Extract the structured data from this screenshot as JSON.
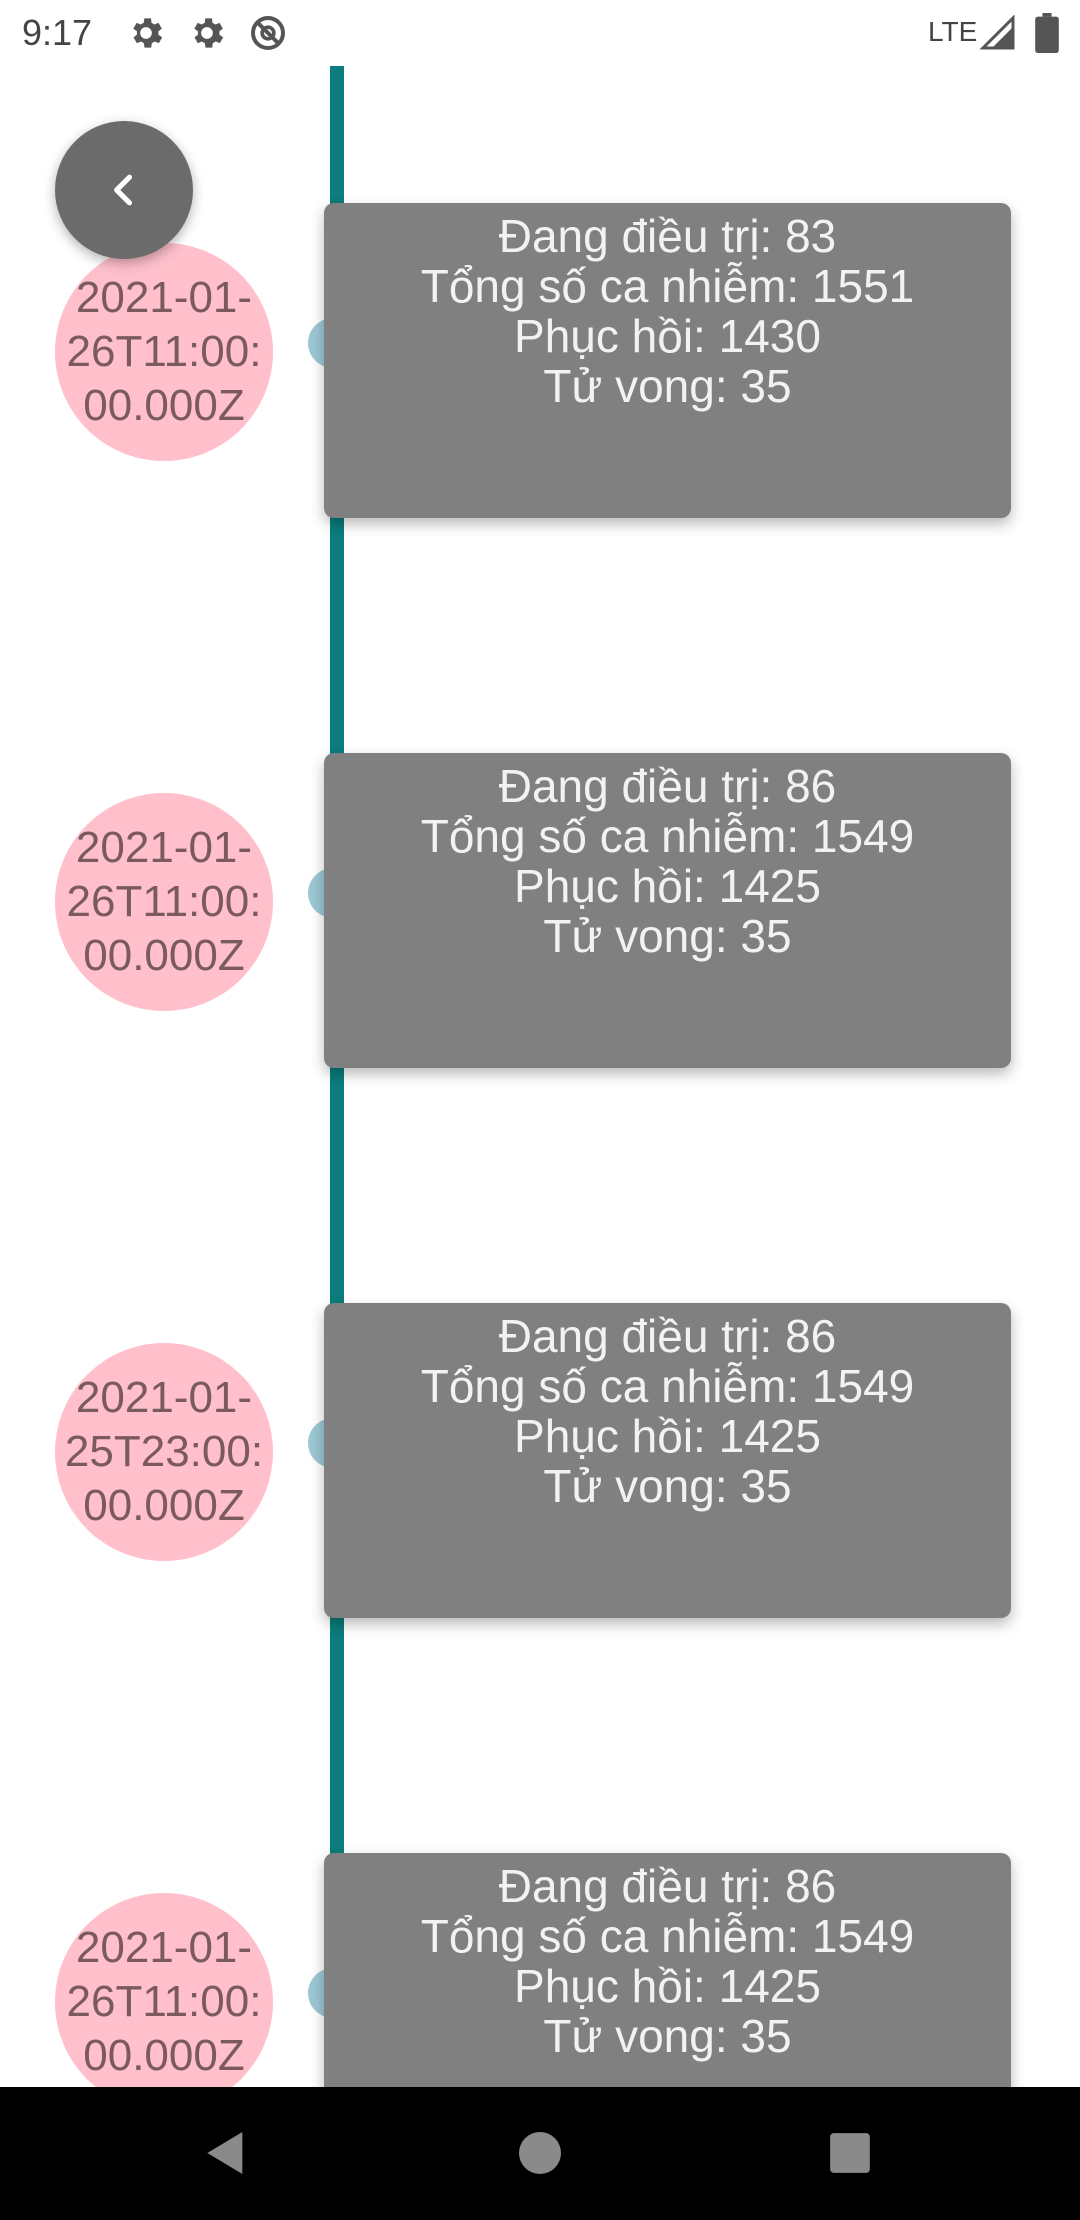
{
  "status_bar": {
    "time": "9:17",
    "network": "LTE",
    "icons": [
      "gear-icon",
      "gear-icon",
      "no-sync-icon",
      "signal-icon",
      "battery-icon"
    ]
  },
  "colors": {
    "timeline_line": "#0a7d7c",
    "date_bubble": "#ffc0cc",
    "node_dot": "#9cc8d4",
    "card": "#808080",
    "back_button": "#6b6b6b"
  },
  "back_button": {
    "icon": "chevron-left-icon"
  },
  "timeline": [
    {
      "date": "2021-01-26T11:00:00.000Z",
      "lines": [
        "Đang điều trị: 83",
        "Tổng số ca nhiễm: 1551",
        "Phục hồi: 1430",
        "Tử vong: 35"
      ]
    },
    {
      "date": "2021-01-26T11:00:00.000Z",
      "lines": [
        "Đang điều trị: 86",
        "Tổng số ca nhiễm: 1549",
        "Phục hồi: 1425",
        "Tử vong: 35"
      ]
    },
    {
      "date": "2021-01-25T23:00:00.000Z",
      "lines": [
        "Đang điều trị: 86",
        "Tổng số ca nhiễm: 1549",
        "Phục hồi: 1425",
        "Tử vong: 35"
      ]
    },
    {
      "date": "2021-01-26T11:00:00.000Z",
      "lines": [
        "Đang điều trị: 86",
        "Tổng số ca nhiễm: 1549",
        "Phục hồi: 1425",
        "Tử vong: 35"
      ]
    }
  ],
  "nav_bar": {
    "buttons": [
      "back-triangle-icon",
      "home-circle-icon",
      "recents-square-icon"
    ]
  }
}
